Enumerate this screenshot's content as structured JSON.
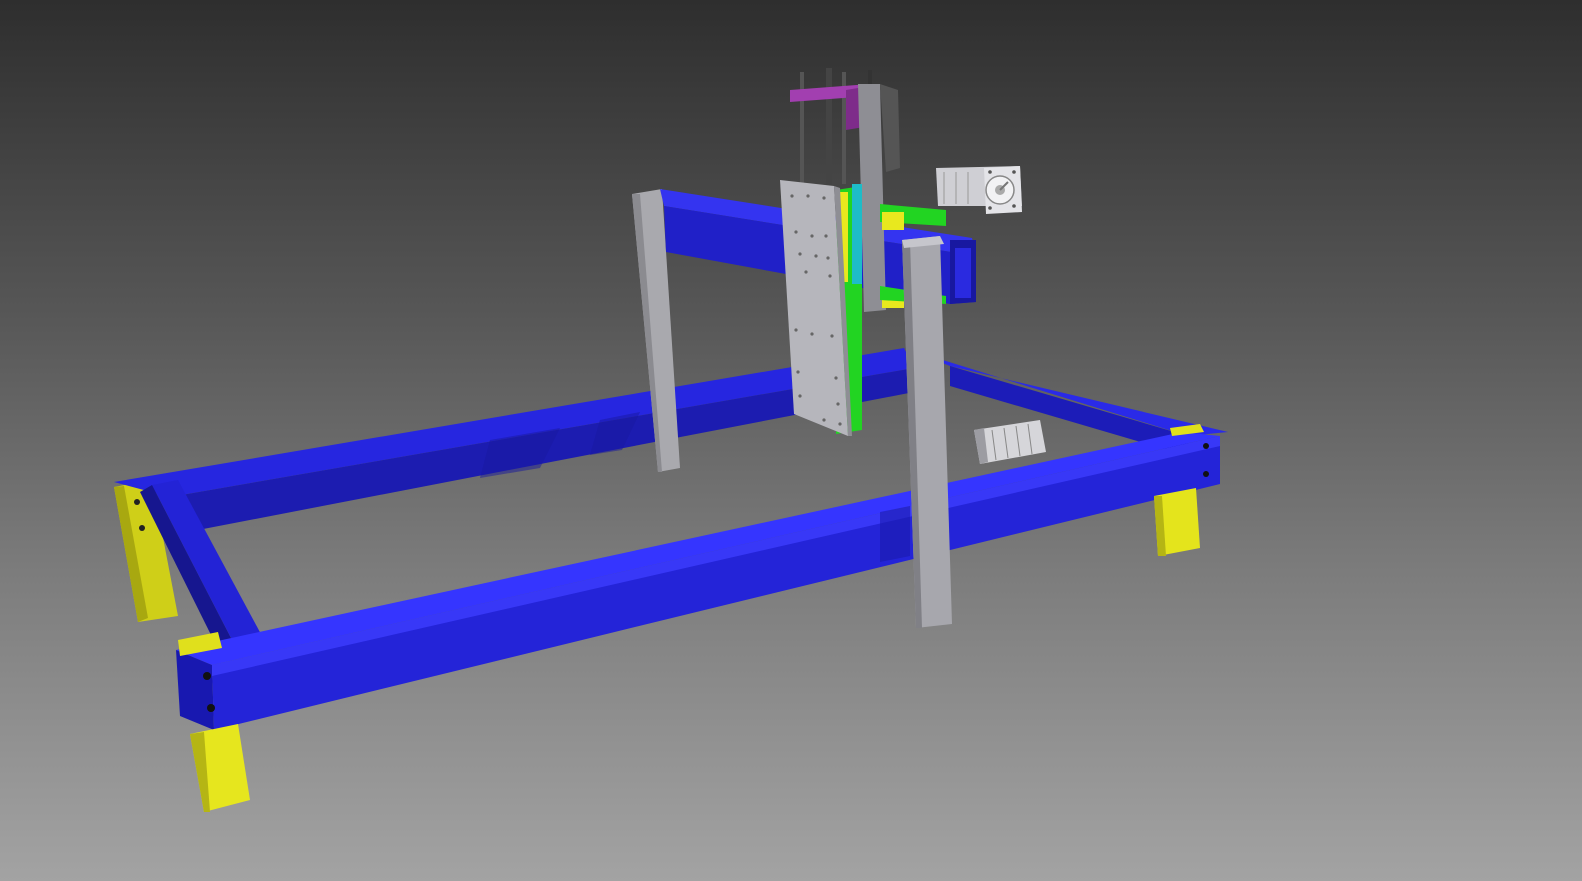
{
  "viewport": {
    "background_top": "#2e2e2e",
    "background_bottom": "#a3a3a3"
  },
  "model": {
    "frame_color": "#2323d6",
    "frame_dark": "#1a1aa8",
    "frame_light": "#3f3fff",
    "leg_color": "#e3e31c",
    "upright_color": "#a7a7ad",
    "plate_color": "#b2b2b8",
    "carriage_color": "#22d422",
    "bracket_color": "#a23fb0",
    "rail_color": "#1ebcc8",
    "motor_color": "#d2d2d6",
    "parts": [
      "base-frame",
      "front-rail",
      "rear-rail",
      "left-crossbar",
      "right-crossbar",
      "leg-front-left",
      "leg-rear-left",
      "leg-front-right",
      "gantry-beam",
      "gantry-upright-left",
      "gantry-upright-right",
      "z-axis-plate",
      "z-axis-carriage",
      "z-axis-top-bracket",
      "lead-screws",
      "gantry-motor",
      "y-axis-motor"
    ]
  }
}
